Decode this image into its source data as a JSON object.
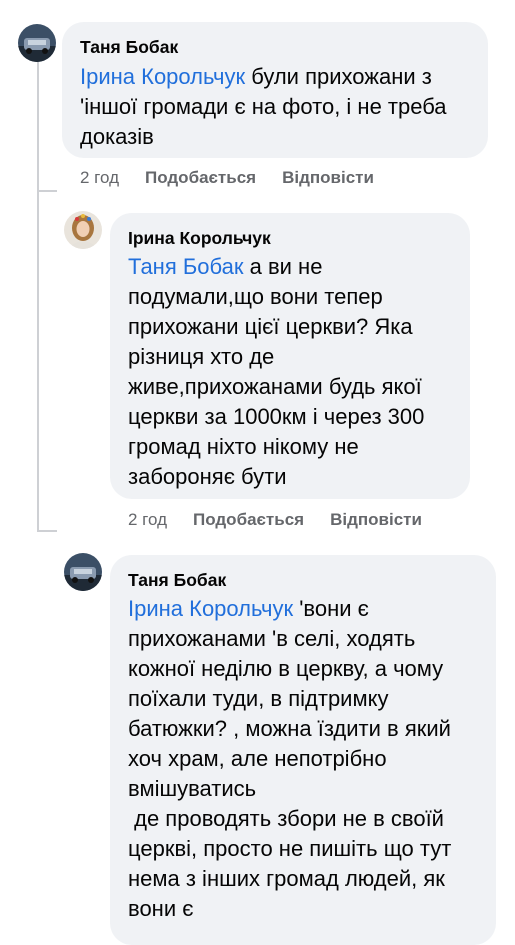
{
  "comments": [
    {
      "author": "Таня Бобак",
      "mention": "Ірина Корольчук",
      "text": " були прихожани з\n'іншої громади є на фото, і не треба\nдоказів",
      "time": "2 год",
      "like_label": "Подобається",
      "reply_label": "Відповісти",
      "avatar_icon": "car-photo-avatar"
    },
    {
      "author": "Ірина Корольчук",
      "mention": "Таня Бобак",
      "text": " а ви не\nподумали,що вони тепер\nприхожани цієї церкви? Яка\nрізниця хто де\nживе,прихожанами будь якої\nцеркви за 1000км і через 300\nгромад ніхто нікому не\nзабороняє бути",
      "time": "2 год",
      "like_label": "Подобається",
      "reply_label": "Відповісти",
      "avatar_icon": "woman-photo-avatar"
    },
    {
      "author": "Таня Бобак",
      "mention": "Ірина Корольчук",
      "text": " 'вони є\nприхожанами 'в селі, ходять\nкожної неділю в церкву, а чому\nпоїхали туди, в підтримку\nбатюжки? , можна їздити в який\nхоч храм, але непотрібно\nвмішуватись\n де проводять збори не в своїй\nцеркві, просто не пишіть що тут\nнема з інших громад людей, як\nвони є",
      "time": "",
      "like_label": "",
      "reply_label": "",
      "avatar_icon": "car-photo-avatar"
    }
  ]
}
